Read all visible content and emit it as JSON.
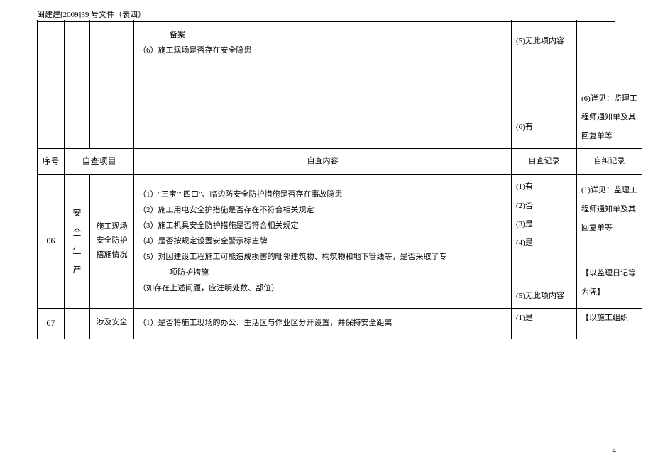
{
  "header": "闽建建[2009]39 号文件（表四）",
  "page_number": "4",
  "top_row": {
    "content_line1": "备案",
    "content_line2": "（6）施工现场是否存在安全隐患",
    "record_line1": "(5)无此项内容",
    "record_line2": "(6)有",
    "remedy": "(6)详见：监理工程师通知单及其回复单等"
  },
  "header_row": {
    "seq": "序号",
    "item": "自查项目",
    "sub": "",
    "content": "自查内容",
    "record": "自查记录",
    "remedy": "自纠记录"
  },
  "row06": {
    "seq": "06",
    "item": "安全生产",
    "sub": "施工现场安全防护措施情况",
    "content_1": "（1）\"三宝\"\"四口\"、临边防安全防护措施是否存在事故隐患",
    "content_2": "（2）施工用电安全护措施是否存在不符合相关规定",
    "content_3": "（3）施工机具安全防护措施是否符合相关规定",
    "content_4": "（4）是否按规定设置安全警示标志牌",
    "content_5": "（5）对因建设工程施工可能造成损害的毗邻建筑物、构筑物和地下管线等，是否采取了专",
    "content_5b": "项防护措施",
    "content_6": "（如存在上述问题，应注明处数、部位）",
    "record_1": "(1)有",
    "record_2": "(2)否",
    "record_3": "(3)是",
    "record_4": "(4)是",
    "record_5": "(5)无此项内容",
    "remedy_1": "(1)详见：监理工程师通知单及其回复单等",
    "remedy_2": "【以监理日记等为凭】"
  },
  "row07": {
    "seq": "07",
    "sub": "涉及安全",
    "content_1": "（1）是否将施工现场的办公、生活区与作业区分开设置，并保持安全距离",
    "record_1": "(1)是",
    "remedy_1": "【以施工组织"
  }
}
